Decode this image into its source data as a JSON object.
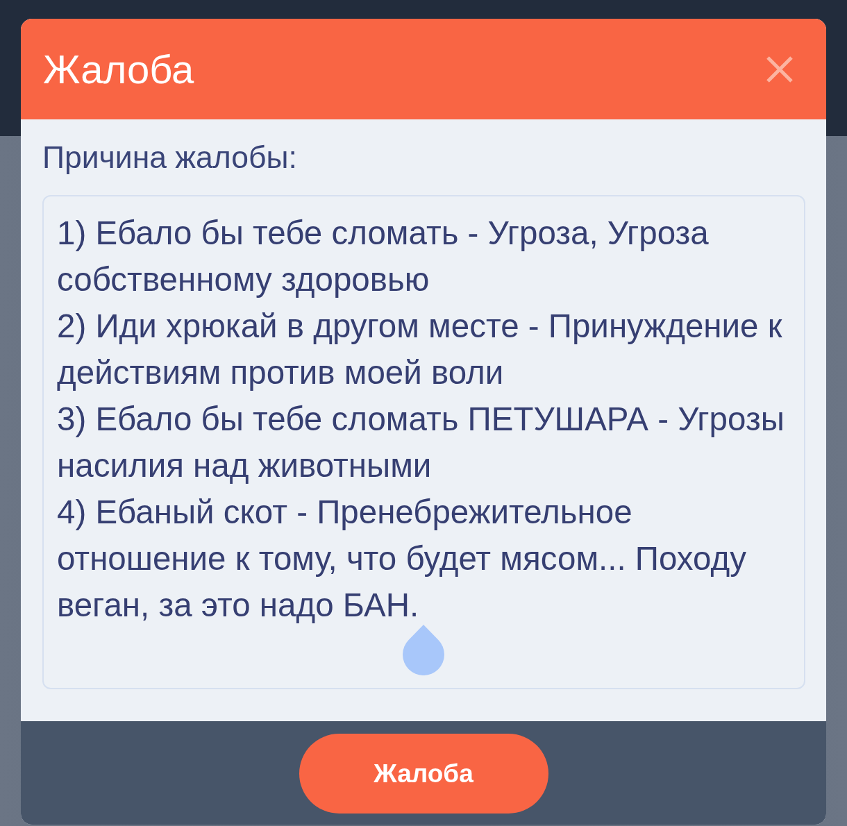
{
  "modal": {
    "title": "Жалоба"
  },
  "form": {
    "label": "Причина жалобы:",
    "reason_field": {
      "value": "1) Ебало бы тебе сломать - Угроза, Угроза собственному здоровью\n2) Иди хрюкай в другом месте - Принуждение к действиям против моей воли\n3) Ебало бы тебе сломать ПЕТУШАРА - Угрозы насилия над животными\n4) Ебаный скот - Пренебрежительное отношение к тому, что будет мясом... Походу веган, за это надо БАН."
    }
  },
  "footer": {
    "submit_button": "Жалоба"
  }
}
